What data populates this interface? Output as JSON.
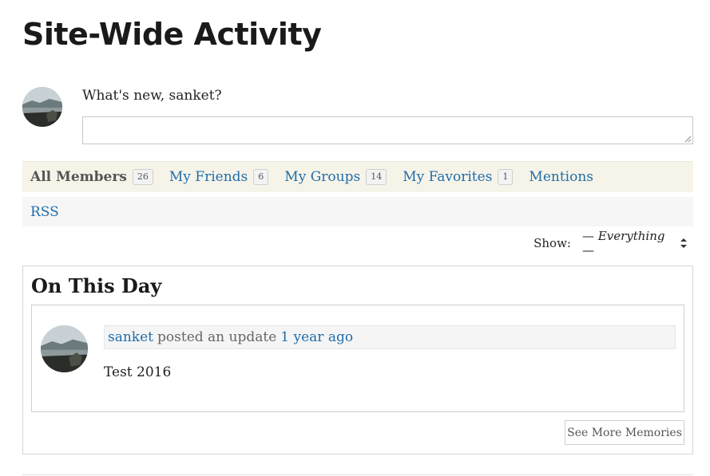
{
  "page": {
    "title": "Site-Wide Activity"
  },
  "post_form": {
    "prompt": "What's new, sanket?",
    "input_value": "",
    "input_placeholder": ""
  },
  "tabs": [
    {
      "label": "All Members",
      "count": "26",
      "active": true
    },
    {
      "label": "My Friends",
      "count": "6",
      "active": false
    },
    {
      "label": "My Groups",
      "count": "14",
      "active": false
    },
    {
      "label": "My Favorites",
      "count": "1",
      "active": false
    },
    {
      "label": "Mentions",
      "count": "",
      "active": false
    }
  ],
  "rss": {
    "label": "RSS"
  },
  "filter": {
    "label": "Show:",
    "selected": "— Everything —"
  },
  "on_this_day": {
    "title": "On This Day",
    "memory": {
      "user": "sanket",
      "action": "posted an update",
      "time": "1 year ago",
      "content": "Test 2016"
    },
    "see_more_label": "See More Memories"
  },
  "colors": {
    "link": "#1f6dac",
    "tabs_background": "#f6f4e8",
    "rss_background": "#f6f6f6",
    "card_header_background": "#f5f5f5"
  },
  "icons": {
    "avatar": "profile-avatar-lake-photo",
    "select_arrows": "up-down-arrows-icon",
    "resize_grip": "resize-grip-icon"
  }
}
